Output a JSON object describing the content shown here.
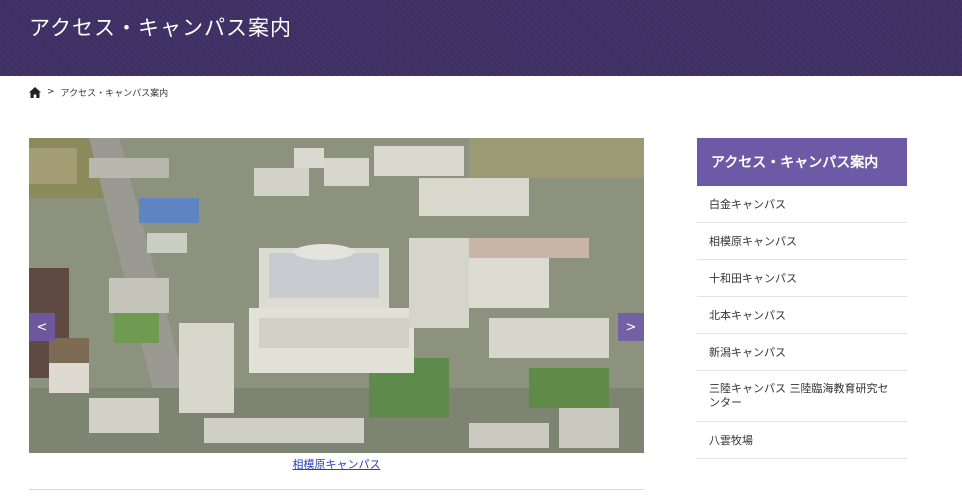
{
  "header": {
    "title": "アクセス・キャンパス案内"
  },
  "breadcrumb": {
    "separator": ">",
    "current": "アクセス・キャンパス案内",
    "home_icon": "home-icon"
  },
  "slider": {
    "prev_label": "<",
    "next_label": ">",
    "caption": "相模原キャンパス"
  },
  "sidebar": {
    "title": "アクセス・キャンパス案内",
    "items": [
      {
        "label": "白金キャンパス"
      },
      {
        "label": "相模原キャンパス"
      },
      {
        "label": "十和田キャンパス"
      },
      {
        "label": "北本キャンパス"
      },
      {
        "label": "新潟キャンパス"
      },
      {
        "label": "三陸キャンパス 三陸臨海教育研究センター"
      },
      {
        "label": "八雲牧場"
      }
    ]
  },
  "colors": {
    "header": "#3d2f63",
    "accent": "#6d5aa6",
    "link": "#2a3ebd"
  }
}
